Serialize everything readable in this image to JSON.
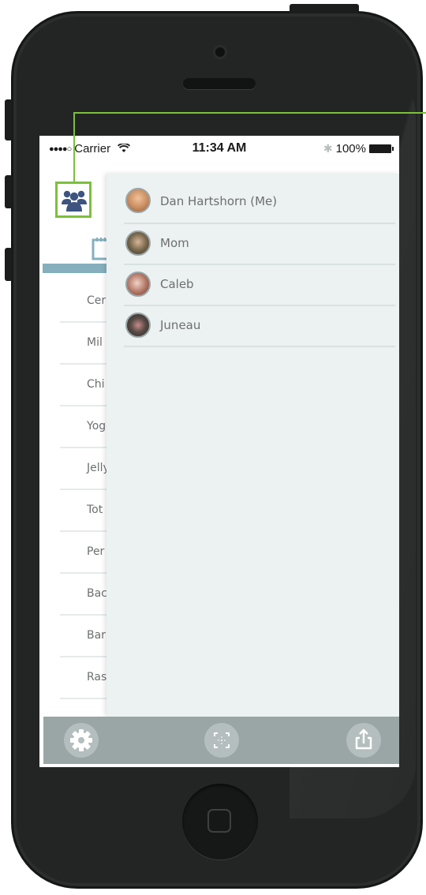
{
  "status_bar": {
    "signal": "●●●●○",
    "carrier": "Carrier",
    "time": "11:34 AM",
    "battery_text": "100%"
  },
  "list_items": [
    "Cer",
    "Mil",
    "Chi",
    "Yog",
    "Jelly",
    "Tot",
    "Per",
    "Bac",
    "Bar",
    "Ras"
  ],
  "people": [
    {
      "name": "Dan Hartshorn (Me)",
      "avatar_color": "#c98d60"
    },
    {
      "name": "Mom",
      "avatar_color": "#7a6a4f"
    },
    {
      "name": "Caleb",
      "avatar_color": "#b07462"
    },
    {
      "name": "Juneau",
      "avatar_color": "#5a4d47"
    }
  ],
  "icons": {
    "people_button": "people-group-icon",
    "calendar": "calendar-icon",
    "settings": "gear-icon",
    "scan": "scan-icon",
    "share": "share-icon"
  },
  "colors": {
    "highlight": "#7dbf3e",
    "panel": "#ecf1f1",
    "accent_bar": "#86afbd",
    "bottom_bar": "#9aa6a6",
    "icon_blue": "#3d5480"
  }
}
